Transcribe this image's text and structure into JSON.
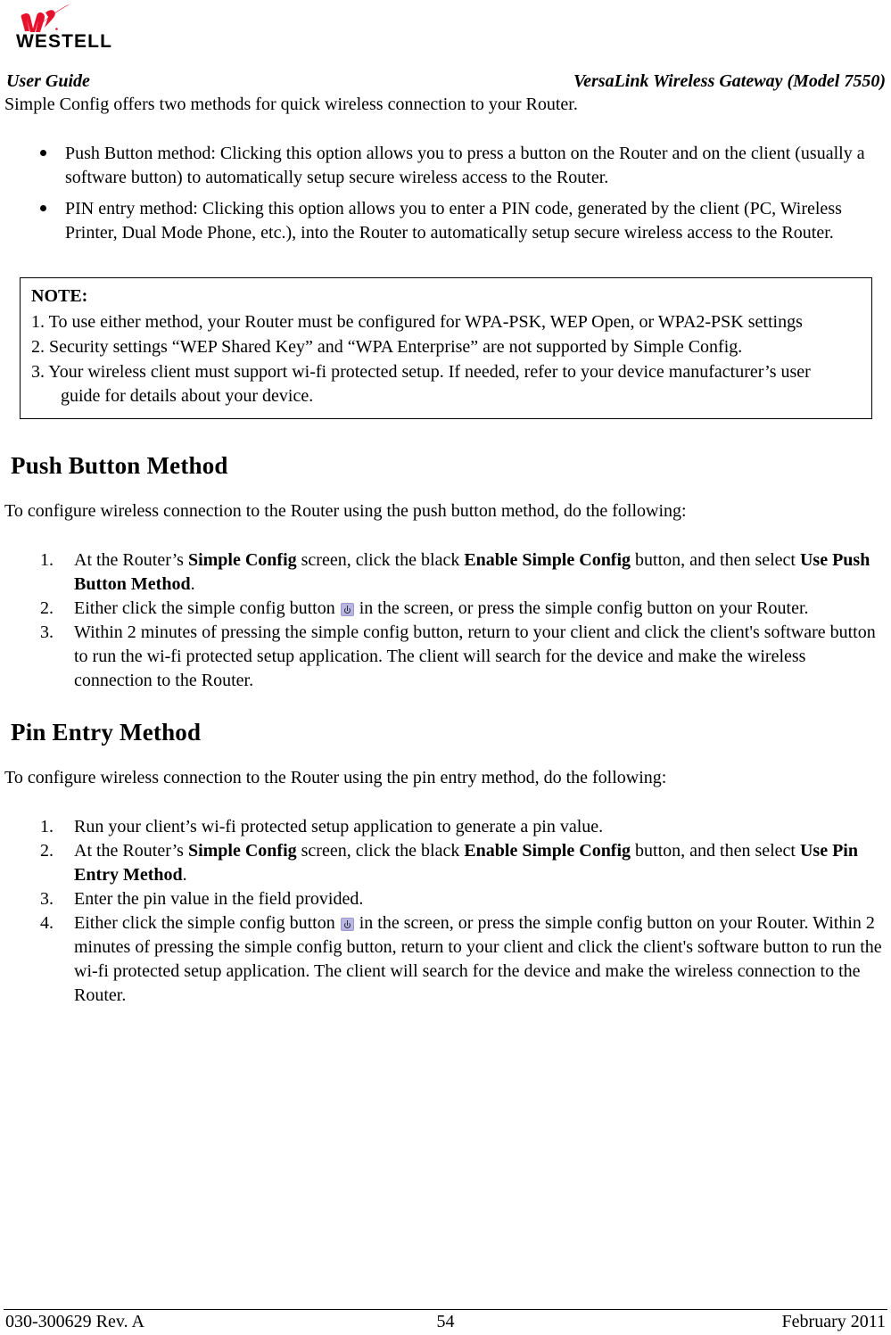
{
  "logo": {
    "wordmark": "WESTELL",
    "mark_color": "#e8112d"
  },
  "running_head": {
    "left": "User Guide",
    "right": "VersaLink Wireless Gateway (Model 7550)"
  },
  "intro": {
    "paragraph": "Simple Config offers two methods for quick wireless connection to your Router."
  },
  "method_bullets": [
    {
      "lead": "Push Button method:",
      "text": "Push Button method: Clicking this option allows you to press a button on the Router and on the client (usually a software button) to automatically setup secure wireless access to the Router."
    },
    {
      "lead": "PIN entry method:",
      "text": "PIN entry method: Clicking this option allows you to enter a PIN code, generated by the client (PC, Wireless Printer, Dual Mode Phone, etc.), into the Router to automatically setup secure wireless access to the Router."
    }
  ],
  "note": {
    "title": "NOTE:",
    "items": [
      "1. To use either method, your Router must be configured for WPA-PSK, WEP Open, or WPA2-PSK settings",
      "2. Security settings “WEP Shared Key” and “WPA Enterprise” are not supported by Simple Config.",
      "3. Your wireless client must support wi-fi protected setup. If needed, refer to your device manufacturer’s user"
    ],
    "item3_continuation": "guide for details about your device."
  },
  "push_button_section": {
    "heading": "Push Button Method",
    "intro": "To configure wireless connection to the Router using the push button method, do the following:",
    "steps": [
      {
        "number": "1.",
        "p1": "At the Router’s ",
        "b1": "Simple Config",
        "p2": " screen, click the black ",
        "b2": "Enable Simple Config",
        "p3": " button, and then select ",
        "b3": "Use Push Button Method",
        "p4": "."
      },
      {
        "number": "2.",
        "p1": "Either click the simple config button ",
        "icon": "simple-config-icon",
        "p2": " in the screen, or press the simple config button on your Router."
      },
      {
        "number": "3.",
        "p1": "Within 2 minutes of pressing the simple config button, return to your client and click the client's software button to run the wi-fi protected setup application. The client will search for the device and make the wireless connection to the Router."
      }
    ]
  },
  "pin_entry_section": {
    "heading": "Pin Entry Method",
    "intro": "To configure wireless connection to the Router using the pin entry method, do the following:",
    "steps": [
      {
        "number": "1.",
        "p1": "Run your client’s wi-fi protected setup application to generate a pin value."
      },
      {
        "number": "2.",
        "p1": "At the Router’s ",
        "b1": "Simple Config",
        "p2": " screen, click the black ",
        "b2": "Enable Simple Config",
        "p3": " button, and then select ",
        "b3": "Use Pin Entry Method",
        "p4": "."
      },
      {
        "number": "3.",
        "p1": "Enter the pin value in the field provided."
      },
      {
        "number": "4.",
        "p1": "Either click the simple config button ",
        "icon": "simple-config-icon",
        "p2": " in the screen, or press the simple config button on your Router. Within 2 minutes of pressing the simple config button, return to your client and click the client's software button to run the wi-fi protected setup application. The client will search for the device and make the wireless connection to the Router."
      }
    ]
  },
  "footer": {
    "left": "030-300629 Rev. A",
    "center": "54",
    "right": "February 2011"
  }
}
